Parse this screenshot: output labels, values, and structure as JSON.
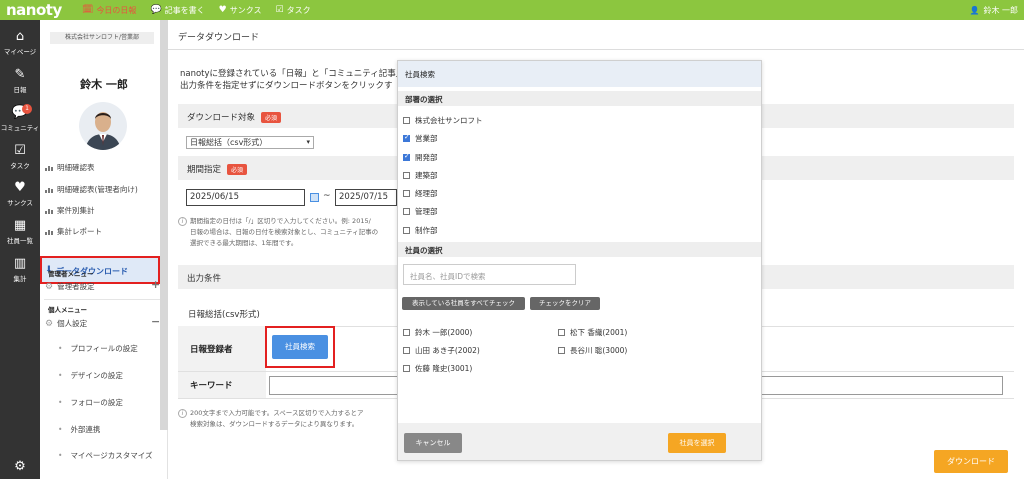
{
  "topbar": {
    "logo": "nanoty",
    "nav": [
      {
        "label": "今日の日報",
        "icon": "calendar-icon",
        "glyph": "🗓",
        "active": true
      },
      {
        "label": "記事を書く",
        "icon": "chat-icon",
        "glyph": "💬",
        "active": false
      },
      {
        "label": "サンクス",
        "icon": "heart-icon",
        "glyph": "♥",
        "active": false
      },
      {
        "label": "タスク",
        "icon": "task-icon",
        "glyph": "☑",
        "active": false
      }
    ],
    "user": "鈴木 一郎",
    "accent": "#8cc63f"
  },
  "iconbar": {
    "items": [
      {
        "label": "マイページ",
        "icon": "home-icon",
        "glyph": "⌂"
      },
      {
        "label": "日報",
        "icon": "edit-icon",
        "glyph": "✎"
      },
      {
        "label": "コミュニティ",
        "icon": "community-icon",
        "glyph": "💬",
        "badge": "1"
      },
      {
        "label": "タスク",
        "icon": "task-icon",
        "glyph": "☑"
      },
      {
        "label": "サンクス",
        "icon": "heart-icon",
        "glyph": "♥"
      },
      {
        "label": "社員一覧",
        "icon": "employee-list-icon",
        "glyph": "▦"
      },
      {
        "label": "集計",
        "icon": "stats-icon",
        "glyph": "▥"
      }
    ],
    "settings_glyph": "⚙"
  },
  "sidebar": {
    "company": "株式会社サンロフト/営業部",
    "user_name": "鈴木 一郎",
    "links": [
      "明細確認表",
      "明細確認表(管理者向け)",
      "案件別集計",
      "集計レポート"
    ],
    "active_link": "データダウンロード",
    "admin_section": "管理者メニュー",
    "admin_settings": "管理者設定",
    "personal_section": "個人メニュー",
    "personal_settings": "個人設定",
    "personal_items": [
      "プロフィールの設定",
      "デザインの設定",
      "フォローの設定",
      "外部連携",
      "マイページカスタマイズ"
    ]
  },
  "main": {
    "page_title": "データダウンロード",
    "intro_line1": "nanotyに登録されている「日報」と「コミュニティ記事」",
    "intro_line2": "出力条件を指定せずにダウンロードボタンをクリックす",
    "download_target_label": "ダウンロード対象",
    "required_badge": "必須",
    "target_select": "日報総括（csv形式）",
    "period_label": "期間指定",
    "date_from": "2025/06/15",
    "date_to": "2025/07/15",
    "period_note1": "期間指定の日付は「/」区切りで入力してください。例: 2015/",
    "period_note2": "日報の場合は、日報の日付を検索対象とし、コミュニティ記事の",
    "period_note3": "選択できる最大期間は、1年間です。",
    "output_conditions": "出力条件",
    "sub_label": "日報総括(csv形式)",
    "reporter_label": "日報登録者",
    "employee_search_button": "社員検索",
    "keyword_label": "キーワード",
    "keyword_value": "",
    "kw_note1": "200文字まで入力可能です。スペース区切りで入力するとア",
    "kw_note2": "検索対象は、ダウンロードするデータにより異なります。",
    "download_button": "ダウンロード"
  },
  "modal": {
    "title": "社員検索",
    "dept_section": "部署の選択",
    "departments": [
      {
        "label": "株式会社サンロフト",
        "checked": false
      },
      {
        "label": "営業部",
        "checked": true
      },
      {
        "label": "開発部",
        "checked": true
      },
      {
        "label": "建築部",
        "checked": false
      },
      {
        "label": "経理部",
        "checked": false
      },
      {
        "label": "管理部",
        "checked": false
      },
      {
        "label": "制作部",
        "checked": false
      }
    ],
    "emp_section": "社員の選択",
    "search_placeholder": "社員名、社員IDで検索",
    "check_all_button": "表示している社員をすべてチェック",
    "clear_button": "チェックをクリア",
    "employees": [
      {
        "label": "鈴木 一郎(2000)",
        "checked": false
      },
      {
        "label": "松下 香織(2001)",
        "checked": false
      },
      {
        "label": "山田 あき子(2002)",
        "checked": false
      },
      {
        "label": "長谷川 聡(3000)",
        "checked": false
      },
      {
        "label": "佐藤 隆史(3001)",
        "checked": false
      }
    ],
    "cancel_button": "キャンセル",
    "select_button": "社員を選択"
  }
}
